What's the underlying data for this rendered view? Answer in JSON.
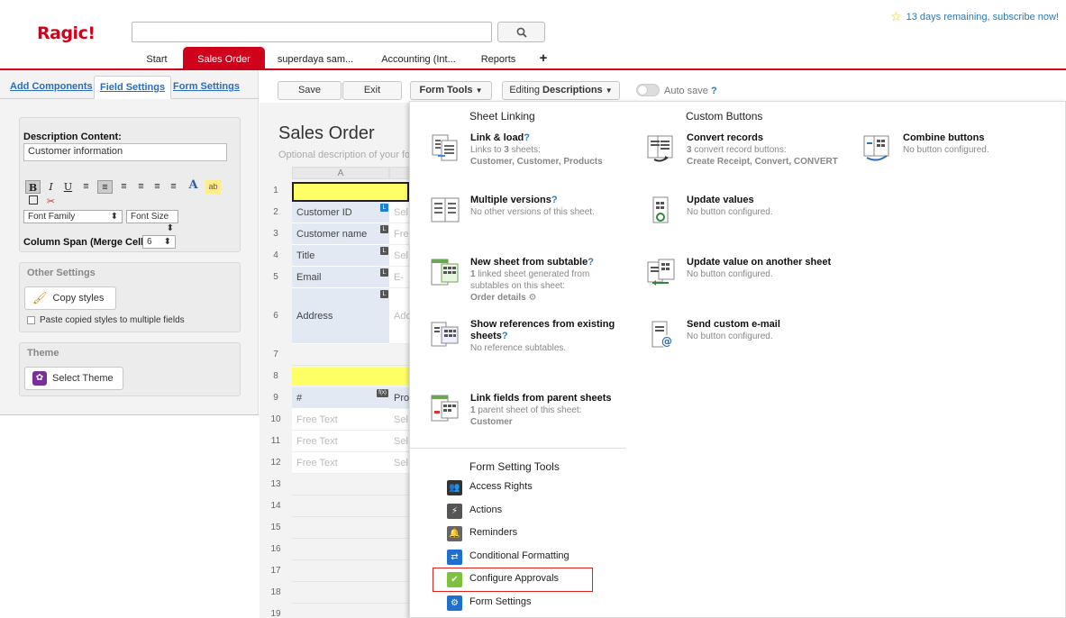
{
  "app": {
    "logo": "Ragic!"
  },
  "trial": {
    "text": "13 days remaining, subscribe now!"
  },
  "tabs": [
    "Start",
    "Sales Order",
    "superdaya sam...",
    "Accounting (Int...",
    "Reports",
    "+"
  ],
  "left_panel": {
    "tabs": [
      "Add Components",
      "Field Settings",
      "Form Settings"
    ],
    "description_label": "Description Content:",
    "description_value": "Customer information",
    "format_buttons": [
      "B",
      "I",
      "U"
    ],
    "font_family": "Font Family",
    "font_size": "Font Size",
    "column_span_label": "Column Span (Merge Cells):",
    "column_span_value": "6",
    "other_settings": "Other Settings",
    "copy_styles": "Copy styles",
    "paste_styles": "Paste copied styles to multiple fields",
    "theme": "Theme",
    "select_theme": "Select Theme"
  },
  "toolbar": {
    "save": "Save",
    "exit": "Exit",
    "form_tools": "Form Tools",
    "editing": "Editing",
    "descriptions": "Descriptions",
    "auto_save": "Auto save",
    "help": "?"
  },
  "form": {
    "title": "Sales Order",
    "desc": "Optional description of your form",
    "col_a": "A",
    "rows": [
      {
        "n": "1"
      },
      {
        "n": "2",
        "label": "Customer ID",
        "val": "Sel"
      },
      {
        "n": "3",
        "label": "Customer name",
        "val": "Fre"
      },
      {
        "n": "4",
        "label": "Title",
        "val": "Sel"
      },
      {
        "n": "5",
        "label": "Email",
        "val": "E-m"
      },
      {
        "n": "6",
        "label": "Address",
        "val": "Add"
      },
      {
        "n": "7"
      },
      {
        "n": "8"
      },
      {
        "n": "9",
        "label": "#",
        "val": "Pro"
      },
      {
        "n": "10",
        "label": "Free Text",
        "val": "Sel"
      },
      {
        "n": "11",
        "label": "Free Text",
        "val": "Sel"
      },
      {
        "n": "12",
        "label": "Free Text",
        "val": "Sel"
      },
      {
        "n": "13"
      },
      {
        "n": "14"
      },
      {
        "n": "15"
      },
      {
        "n": "16"
      },
      {
        "n": "17"
      },
      {
        "n": "18"
      },
      {
        "n": "19"
      }
    ]
  },
  "menu": {
    "sheet_linking": "Sheet Linking",
    "custom_buttons": "Custom Buttons",
    "link_load": {
      "title": "Link & load",
      "sub1": "Links to ",
      "count": "3",
      "sub2": " sheets:",
      "items": "Customer, Customer, Products"
    },
    "multiple_versions": {
      "title": "Multiple versions",
      "sub": "No other versions of this sheet."
    },
    "new_sheet_subtable": {
      "title": "New sheet from subtable",
      "count": "1",
      "sub": " linked sheet generated from subtables on this sheet:",
      "items": "Order details"
    },
    "show_references": {
      "title": "Show references from existing sheets",
      "sub": "No reference subtables."
    },
    "link_parent": {
      "title": "Link fields from parent sheets",
      "count": "1",
      "sub": " parent sheet of this sheet:",
      "items": "Customer"
    },
    "convert_records": {
      "title": "Convert records",
      "count": "3",
      "sub": " convert record buttons:",
      "items": "Create Receipt, Convert, CONVERT"
    },
    "update_values": {
      "title": "Update values",
      "sub": "No button configured."
    },
    "update_other": {
      "title": "Update value on another sheet",
      "sub": "No button configured."
    },
    "send_email": {
      "title": "Send custom e-mail",
      "sub": "No button configured."
    },
    "combine_buttons": {
      "title": "Combine buttons",
      "sub": "No button configured."
    },
    "form_setting_tools": "Form Setting Tools",
    "tools": [
      "Access Rights",
      "Actions",
      "Reminders",
      "Conditional Formatting",
      "Configure Approvals",
      "Form Settings"
    ]
  }
}
